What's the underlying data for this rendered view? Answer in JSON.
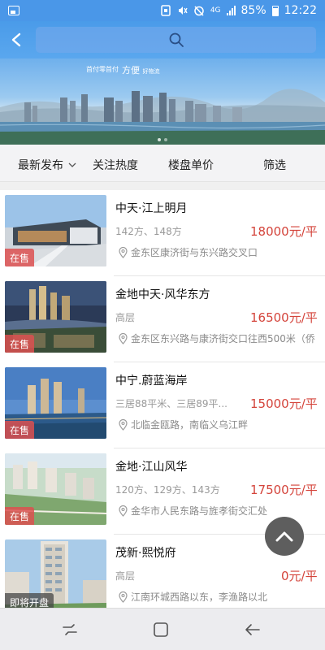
{
  "status_bar": {
    "battery": "85%",
    "time": "12:22",
    "network": "4G"
  },
  "header": {
    "back_icon": "back-arrow-icon",
    "search_icon": "search-icon"
  },
  "banner": {
    "slogan_small": "首付零首付",
    "slogan_main": "方便",
    "slogan_main_small": "好物流"
  },
  "filters": [
    {
      "label": "最新发布",
      "has_dropdown": true
    },
    {
      "label": "关注热度"
    },
    {
      "label": "楼盘单价"
    },
    {
      "label": "筛选"
    }
  ],
  "listings": [
    {
      "name": "中天·江上明月",
      "spec": "142方、148方",
      "price": "18000元/平",
      "address": "金东区康济街与东兴路交叉口",
      "status": "在售"
    },
    {
      "name": "金地中天·风华东方",
      "spec": "高层",
      "price": "16500元/平",
      "address": "金东区东兴路与康济街交口往西500米（侨",
      "status": "在售"
    },
    {
      "name": "中宁.蔚蓝海岸",
      "spec": "三居88平米、三居89平...",
      "price": "15000元/平",
      "address": "北临金瓯路，南临义乌江畔",
      "status": "在售"
    },
    {
      "name": "金地·江山风华",
      "spec": "120方、129方、143方",
      "price": "17500元/平",
      "address": "金华市人民东路与旌孝街交汇处",
      "status": "在售"
    },
    {
      "name": "茂新·熙悦府",
      "spec": "高层",
      "price": "0元/平",
      "address": "江南环城西路以东，李渔路以北",
      "status": "即将开盘"
    }
  ],
  "colors": {
    "accent": "#4a97e8",
    "price": "#d4443b",
    "badge_sale": "#dc5050"
  }
}
